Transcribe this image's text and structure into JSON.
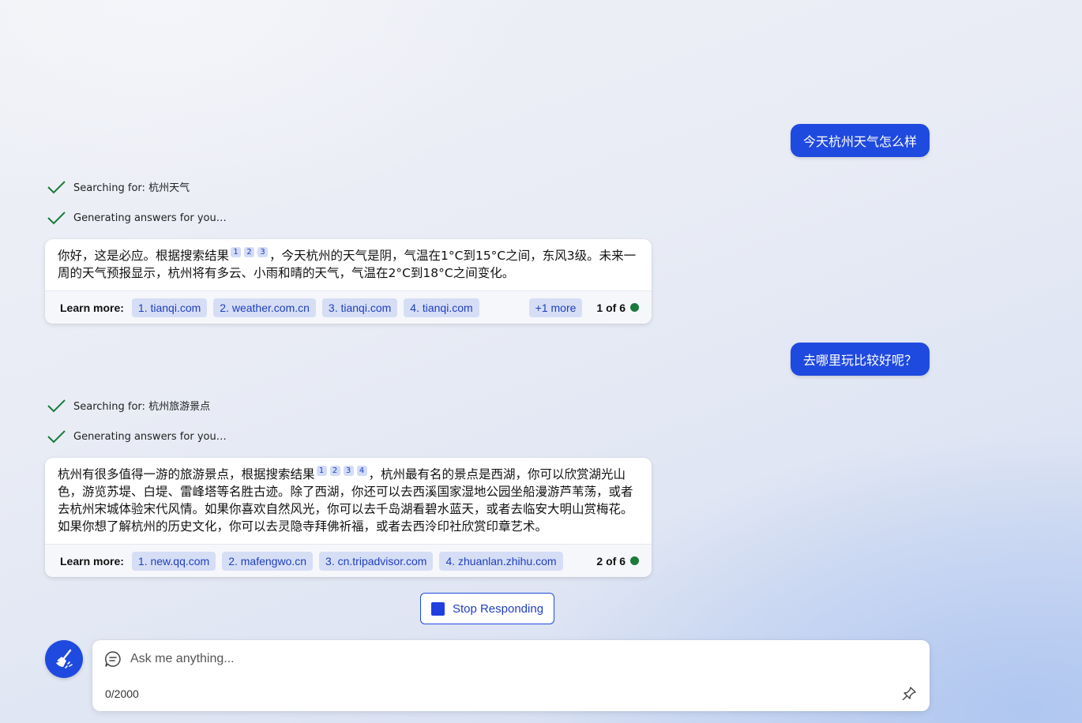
{
  "conversation": [
    {
      "user_message": "今天杭州天气怎么样",
      "progress": [
        {
          "label": "Searching for: ",
          "query": "杭州天气"
        },
        {
          "label": "Generating answers for you…",
          "query": ""
        }
      ],
      "response": {
        "text_before": "你好，这是必应。根据搜索结果",
        "citations": [
          "1",
          "2",
          "3"
        ],
        "text_after": "，今天杭州的天气是阴，气温在1°C到15°C之间，东风3级。未来一周的天气预报显示，杭州将有多云、小雨和晴的天气，气温在2°C到18°C之间变化。"
      },
      "learn_more_label": "Learn more:",
      "links": [
        "1. tianqi.com",
        "2. weather.com.cn",
        "3. tianqi.com",
        "4. tianqi.com"
      ],
      "more_label": "+1 more",
      "turn_counter": "1 of 6"
    },
    {
      "user_message": "去哪里玩比较好呢？",
      "progress": [
        {
          "label": "Searching for: ",
          "query": "杭州旅游景点"
        },
        {
          "label": "Generating answers for you…",
          "query": ""
        }
      ],
      "response": {
        "text_before": "杭州有很多值得一游的旅游景点，根据搜索结果",
        "citations": [
          "1",
          "2",
          "3",
          "4"
        ],
        "text_after": "，杭州最有名的景点是西湖，你可以欣赏湖光山色，游览苏堤、白堤、雷峰塔等名胜古迹。除了西湖，你还可以去西溪国家湿地公园坐船漫游芦苇荡，或者去杭州宋城体验宋代风情。如果你喜欢自然风光，你可以去千岛湖看碧水蓝天，或者去临安大明山赏梅花。如果你想了解杭州的历史文化，你可以去灵隐寺拜佛祈福，或者去西泠印社欣赏印章艺术。"
      },
      "learn_more_label": "Learn more:",
      "links": [
        "1. new.qq.com",
        "2. mafengwo.cn",
        "3. cn.tripadvisor.com",
        "4. zhuanlan.zhihu.com"
      ],
      "more_label": "",
      "turn_counter": "2 of 6"
    }
  ],
  "stop_button": {
    "label": "Stop Responding"
  },
  "composer": {
    "placeholder": "Ask me anything...",
    "value": "",
    "char_count": "0/2000"
  },
  "colors": {
    "accent": "#1f4ae0",
    "chip_bg": "#d6def6",
    "status_dot": "#1a7a3b",
    "check": "#1a7a3b"
  },
  "icons": {
    "progress_done": "checkmark-icon",
    "new_topic": "broom-icon",
    "composer": "chat-bubble-icon",
    "pin": "pin-icon",
    "stop": "stop-square-icon"
  }
}
